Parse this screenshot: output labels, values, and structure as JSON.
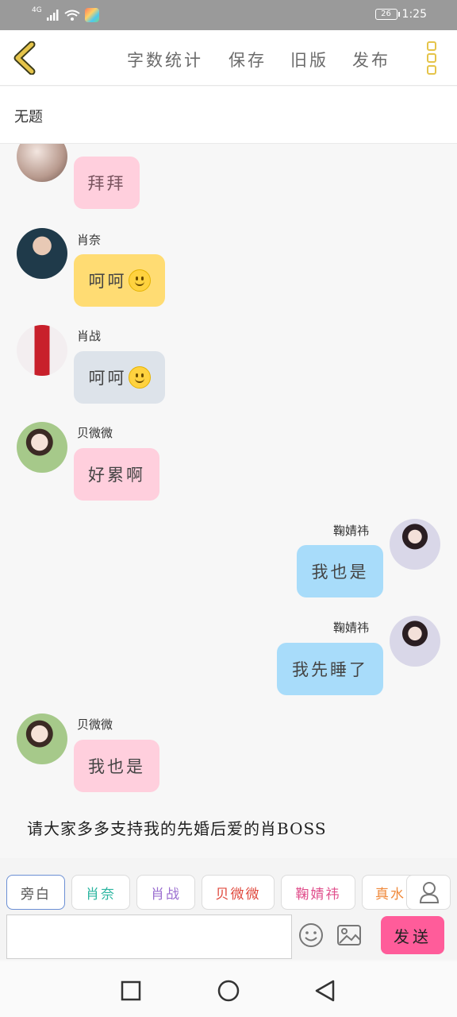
{
  "status_bar": {
    "network": "4G",
    "battery": "26",
    "time": "1:25"
  },
  "toolbar": {
    "word_count": "字数统计",
    "save": "保存",
    "old_version": "旧版",
    "publish": "发布"
  },
  "document": {
    "title": "无题"
  },
  "messages": [
    {
      "name": "",
      "text": "拜拜",
      "side": "left"
    },
    {
      "name": "肖奈",
      "text": "呵呵",
      "side": "left",
      "emoji": "slightly-smiling-face"
    },
    {
      "name": "肖战",
      "text": "呵呵",
      "side": "left",
      "emoji": "slightly-smiling-face"
    },
    {
      "name": "贝微微",
      "text": "好累啊",
      "side": "left"
    },
    {
      "name": "鞠婧祎",
      "text": "我也是",
      "side": "right"
    },
    {
      "name": "鞠婧祎",
      "text": "我先睡了",
      "side": "right"
    },
    {
      "name": "贝微微",
      "text": "我也是",
      "side": "left"
    }
  ],
  "narration": "请大家多多支持我的先婚后爱的肖BOSS",
  "roles": [
    {
      "label": "旁白",
      "color": "#555555"
    },
    {
      "label": "肖奈",
      "color": "#2bb5a0"
    },
    {
      "label": "肖战",
      "color": "#9b6fd0"
    },
    {
      "label": "贝微微",
      "color": "#e0483c"
    },
    {
      "label": "鞠婧祎",
      "color": "#e04f8c"
    },
    {
      "label": "真水",
      "color": "#f08a3c"
    }
  ],
  "composer": {
    "placeholder": "",
    "send_label": "发送"
  },
  "colors": {
    "accent_yellow": "#e5c44a",
    "pink_bubble": "#ffcfdd",
    "yellow_bubble": "#ffdc73",
    "gray_bubble": "#dde3ea",
    "blue_bubble": "#a8dcfa",
    "send_button": "#ff5c9a"
  }
}
